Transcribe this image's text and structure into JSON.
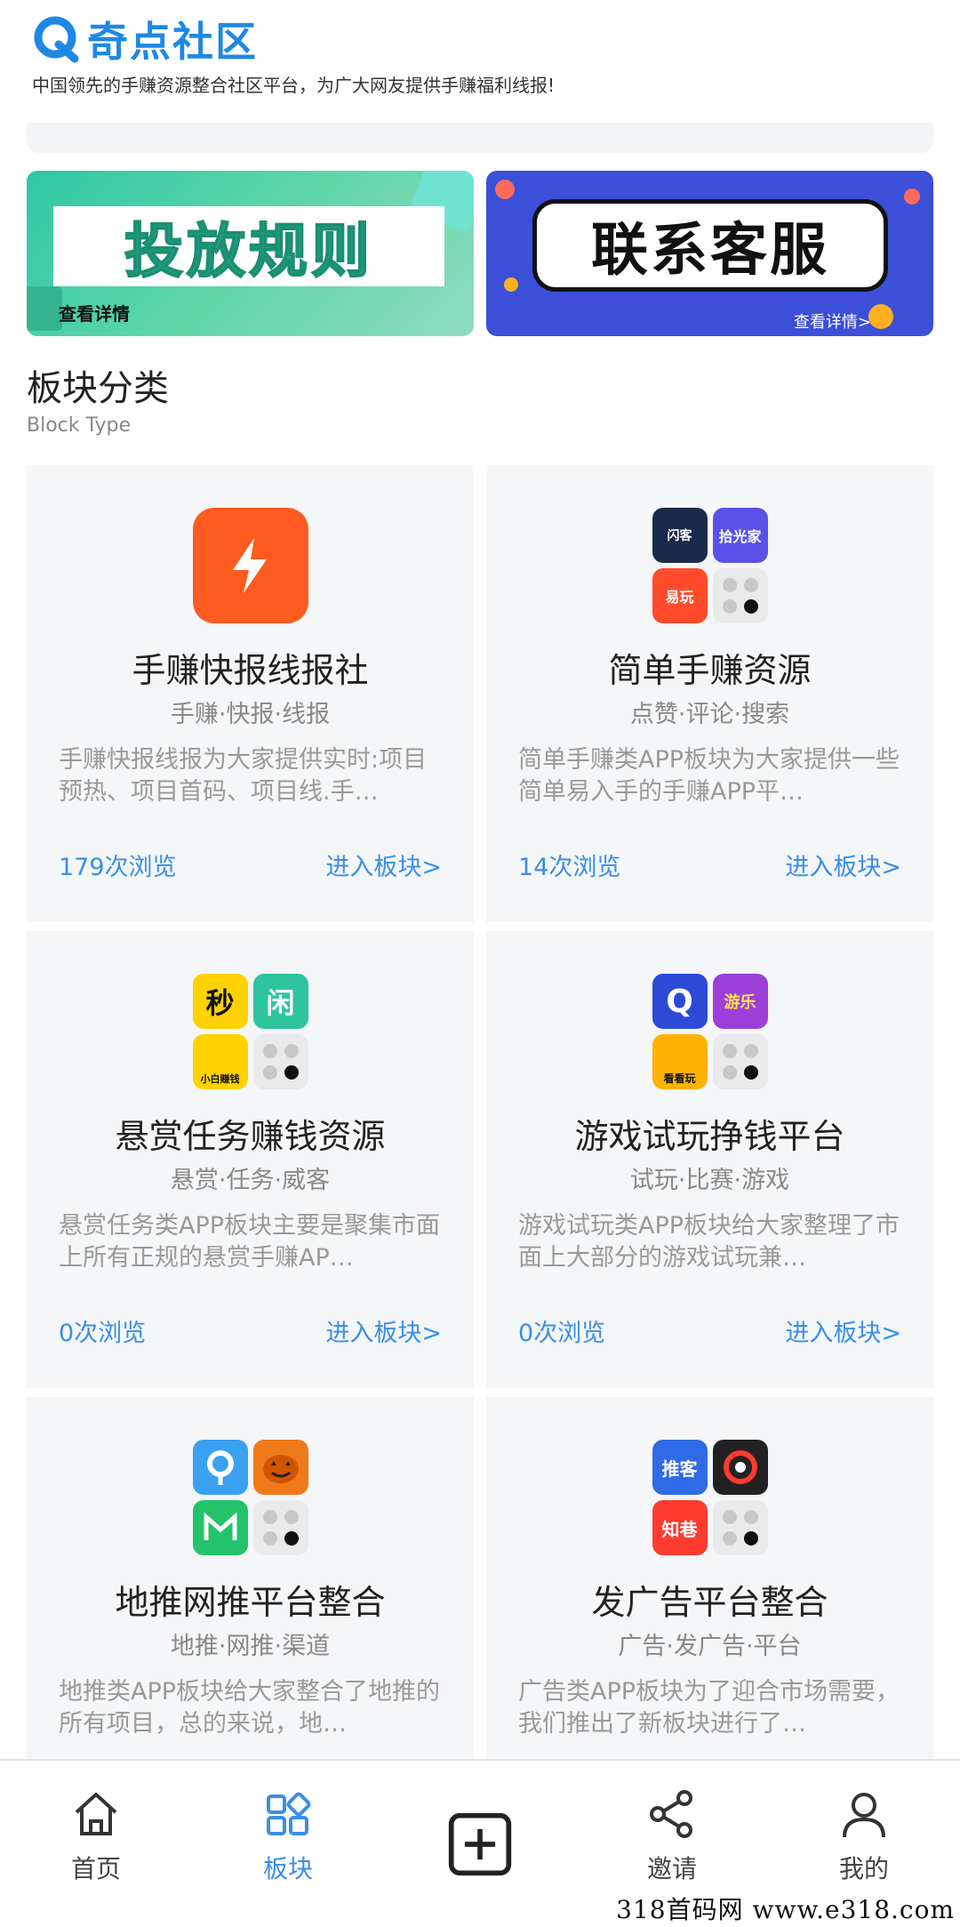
{
  "header": {
    "logo_text": "奇点社区",
    "tagline": "中国领先的手赚资源整合社区平台，为广大网友提供手赚福利线报!"
  },
  "banners": [
    {
      "title": "投放规则",
      "more": "查看详情"
    },
    {
      "title": "联系客服",
      "more": "查看详情>"
    }
  ],
  "section": {
    "title": "板块分类",
    "subtitle": "Block Type"
  },
  "cards": [
    {
      "title": "手赚快报线报社",
      "tags": "手赚·快报·线报",
      "desc": "手赚快报线报为大家提供实时:项目预热、项目首码、项目线.手…",
      "views": "179次浏览",
      "enter": "进入板块>"
    },
    {
      "title": "简单手赚资源",
      "tags": "点赞·评论·搜索",
      "desc": "简单手赚类APP板块为大家提供一些简单易入手的手赚APP平…",
      "views": "14次浏览",
      "enter": "进入板块>",
      "icons": [
        "闪客",
        "拾光家",
        "易玩"
      ]
    },
    {
      "title": "悬赏任务赚钱资源",
      "tags": "悬赏·任务·威客",
      "desc": "悬赏任务类APP板块主要是聚集市面上所有正规的悬赏手赚AP…",
      "views": "0次浏览",
      "enter": "进入板块>",
      "icons": [
        "秒",
        "闲",
        "小白赚钱"
      ]
    },
    {
      "title": "游戏试玩挣钱平台",
      "tags": "试玩·比赛·游戏",
      "desc": "游戏试玩类APP板块给大家整理了市面上大部分的游戏试玩兼…",
      "views": "0次浏览",
      "enter": "进入板块>",
      "icons": [
        "Q",
        "游乐",
        "看看玩"
      ]
    },
    {
      "title": "地推网推平台整合",
      "tags": "地推·网推·渠道",
      "desc": "地推类APP板块给大家整合了地推的所有项目，总的来说，地…",
      "icons": [
        "",
        "",
        ""
      ]
    },
    {
      "title": "发广告平台整合",
      "tags": "广告·发广告·平台",
      "desc": "广告类APP板块为了迎合市场需要，我们推出了新板块进行了…",
      "icons": [
        "推客",
        "",
        "知巷"
      ]
    }
  ],
  "nav": [
    {
      "label": "首页",
      "icon": "home-icon"
    },
    {
      "label": "板块",
      "icon": "grid-icon"
    },
    {
      "label": "",
      "icon": "plus-icon"
    },
    {
      "label": "邀请",
      "icon": "share-icon"
    },
    {
      "label": "我的",
      "icon": "user-icon"
    }
  ],
  "watermark": "318首码网  www.e318.com",
  "colors": {
    "accent": "#3a8ee6",
    "logo": "#1e88e5",
    "card_bg": "#f4f6f8",
    "orange_icon": "#ff5a1f"
  }
}
